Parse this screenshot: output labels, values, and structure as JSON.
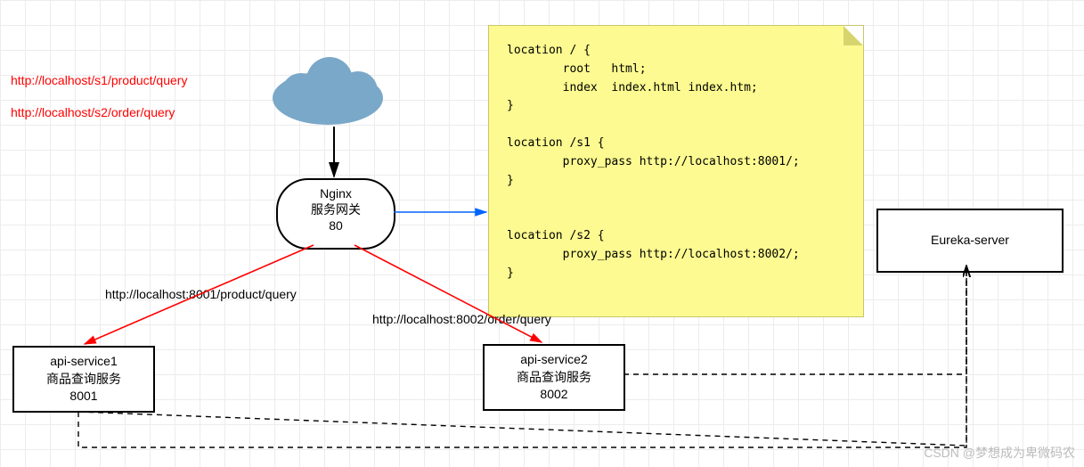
{
  "urls": {
    "u1": "http://localhost/s1/product/query",
    "u2": "http://localhost/s2/order/query",
    "svc1url": "http://localhost:8001/product/query",
    "svc2url": "http://localhost:8002/order/query"
  },
  "nginx": {
    "title": "Nginx",
    "sub": "服务网关",
    "port": "80"
  },
  "note": {
    "text": "location / {\n        root   html;\n        index  index.html index.htm;\n}\n\nlocation /s1 {\n        proxy_pass http://localhost:8001/;\n}\n\n\nlocation /s2 {\n        proxy_pass http://localhost:8002/;\n}"
  },
  "svc1": {
    "name": "api-service1",
    "desc": "商品查询服务",
    "port": "8001"
  },
  "svc2": {
    "name": "api-service2",
    "desc": "商品查询服务",
    "port": "8002"
  },
  "eureka": {
    "name": "Eureka-server"
  },
  "watermark": "CSDN @梦想成为卑微码农"
}
